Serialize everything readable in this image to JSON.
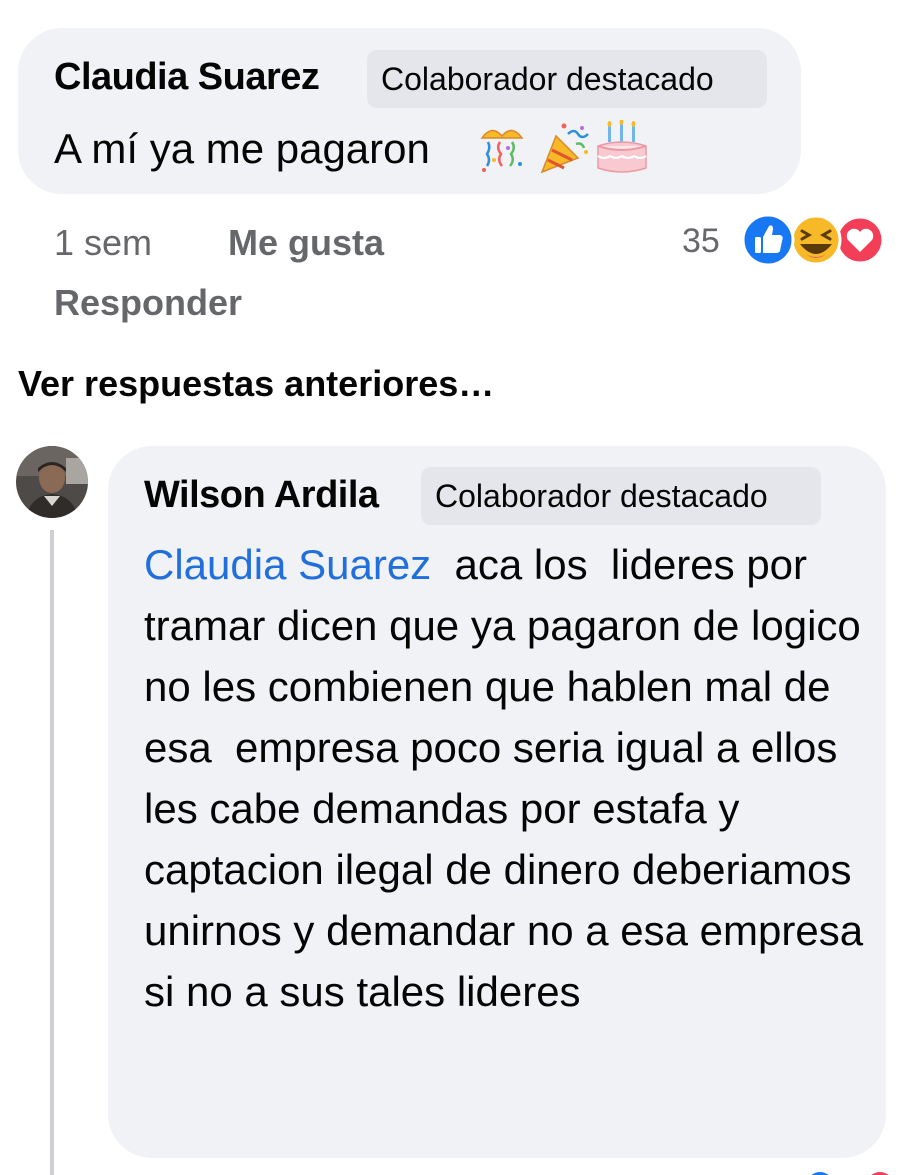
{
  "comment": {
    "author": "Claudia Suarez",
    "badge": "Colaborador destacado",
    "text": "A mí ya me pagaron",
    "emojis": [
      "confetti-ball-icon",
      "party-popper-icon",
      "birthday-cake-icon"
    ],
    "time": "1 sem",
    "like_label": "Me gusta",
    "reply_label": "Responder",
    "reaction_count": "35",
    "reactions": [
      "like-icon",
      "haha-icon",
      "love-icon"
    ]
  },
  "view_previous_replies": "Ver respuestas anteriores…",
  "reply": {
    "author": "Wilson Ardila",
    "badge": "Colaborador destacado",
    "mention": "Claudia Suarez",
    "text": "  aca los  lideres por tramar dicen que ya pagaron de logico no les combienen que hablen mal de esa  empresa poco seria igual a ellos les cabe demandas por estafa y captacion ilegal de dinero deberiamos unirnos y demandar no a esa empresa si no a sus tales lideres"
  },
  "colors": {
    "bubble": "#f0f2f5",
    "badge": "#e4e6eb",
    "meta_text": "#65676b",
    "mention": "#216fdb",
    "like_blue": "#1877f2",
    "love_red": "#f33e58",
    "haha_yellow": "#f7b928"
  }
}
